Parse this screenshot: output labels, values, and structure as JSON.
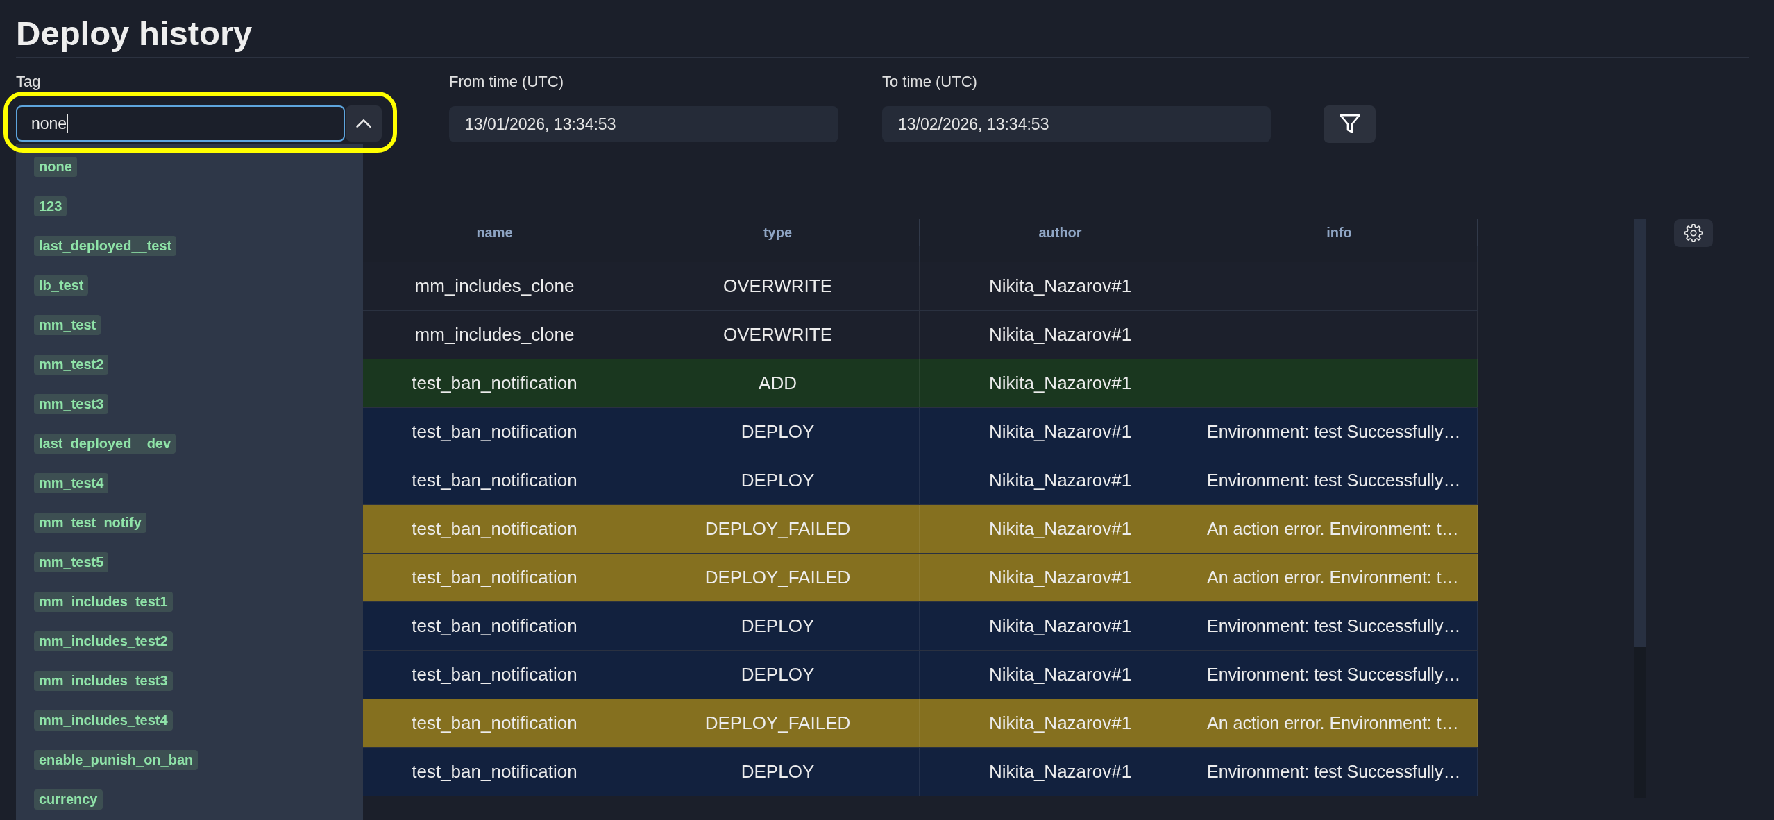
{
  "page": {
    "title": "Deploy history"
  },
  "filters": {
    "tag": {
      "label": "Tag",
      "value": "none",
      "focused": true,
      "expanded": true,
      "highlighted": true,
      "options": [
        "none",
        "123",
        "last_deployed__test",
        "lb_test",
        "mm_test",
        "mm_test2",
        "mm_test3",
        "last_deployed__dev",
        "mm_test4",
        "mm_test_notify",
        "mm_test5",
        "mm_includes_test1",
        "mm_includes_test2",
        "mm_includes_test3",
        "mm_includes_test4",
        "enable_punish_on_ban",
        "currency"
      ]
    },
    "from_time": {
      "label": "From time (UTC)",
      "value": "13/01/2026, 13:34:53"
    },
    "to_time": {
      "label": "To time (UTC)",
      "value": "13/02/2026, 13:34:53"
    }
  },
  "table": {
    "columns": [
      "name",
      "type",
      "author",
      "info"
    ],
    "rows": [
      {
        "name": "mm_includes_clone",
        "type": "OVERWRITE",
        "author": "Nikita_Nazarov#1",
        "color": "#1c202c"
      },
      {
        "name": "mm_includes_clone",
        "type": "OVERWRITE",
        "author": "Nikita_Nazarov#1",
        "color": "#1c202c"
      },
      {
        "name": "test_ban_notification",
        "type": "ADD",
        "author": "Nikita_Nazarov#1",
        "color": "#1a371f"
      },
      {
        "name": "test_ban_notification",
        "type": "DEPLOY",
        "author": "Nikita_Nazarov#1",
        "info": "Environment: test Successfully…",
        "color": "#12213e"
      },
      {
        "name": "test_ban_notification",
        "type": "DEPLOY",
        "author": "Nikita_Nazarov#1",
        "info": "Environment: test Successfully…",
        "color": "#12213e"
      },
      {
        "name": "test_ban_notification",
        "type": "DEPLOY_FAILED",
        "author": "Nikita_Nazarov#1",
        "info": "An action error. Environment: t…",
        "color": "#85701f"
      },
      {
        "name": "test_ban_notification",
        "type": "DEPLOY_FAILED",
        "author": "Nikita_Nazarov#1",
        "info": "An action error. Environment: t…",
        "color": "#85701f"
      },
      {
        "name": "test_ban_notification",
        "type": "DEPLOY",
        "author": "Nikita_Nazarov#1",
        "info": "Environment: test Successfully…",
        "color": "#12213e"
      },
      {
        "name": "test_ban_notification",
        "type": "DEPLOY",
        "author": "Nikita_Nazarov#1",
        "info": "Environment: test Successfully…",
        "color": "#12213e"
      },
      {
        "name": "test_ban_notification",
        "type": "DEPLOY_FAILED",
        "author": "Nikita_Nazarov#1",
        "info": "An action error. Environment: t…",
        "color": "#85701f"
      },
      {
        "name": "test_ban_notification",
        "type": "DEPLOY",
        "author": "Nikita_Nazarov#1",
        "info": "Environment: test Successfully…",
        "color": "#12213e"
      }
    ]
  }
}
